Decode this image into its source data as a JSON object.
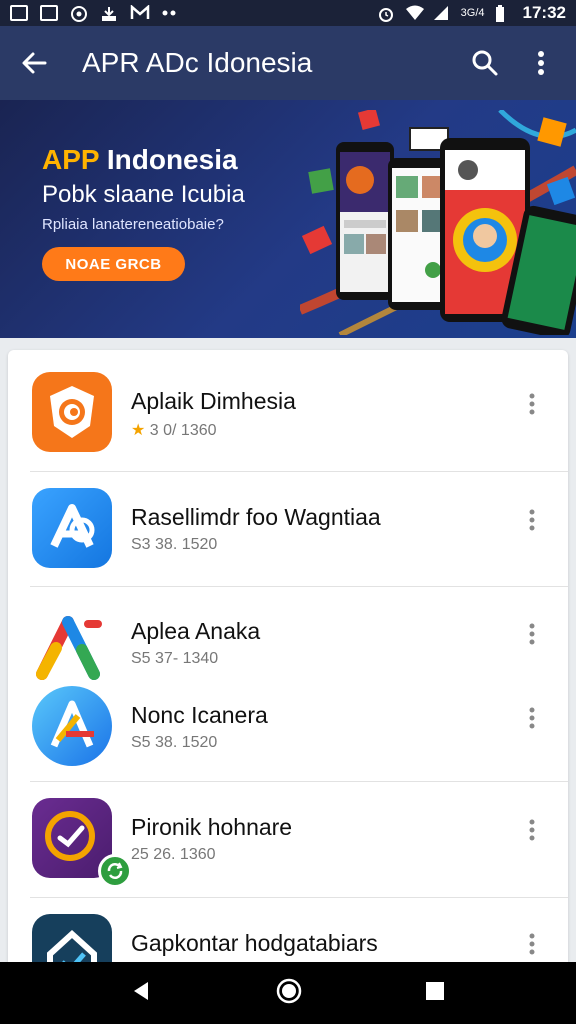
{
  "status_bar": {
    "time": "17:32",
    "signal_text": "3G/4"
  },
  "app_bar": {
    "title": "APR ADc Idonesia"
  },
  "banner": {
    "title_accent": "APP",
    "title_rest": " Indonesia",
    "subtitle": "Pobk slaane Icubia",
    "description": "Rpliaia lanatereneatiobaie?",
    "cta_label": "NOAE GRCB"
  },
  "apps": [
    {
      "name": "Aplaik Dimhesia",
      "meta": "3 0/ 1360",
      "rating_star": true
    },
    {
      "name": "Rasellimdr foo Wagntiaa",
      "meta": "S3 38. 1520"
    },
    {
      "name": "Aplea Anaka",
      "meta": "S5 37- 1340"
    },
    {
      "name": "Nonc Icanera",
      "meta": "S5 38. 1520"
    },
    {
      "name": "Pironik hohnare",
      "meta": "25 26. 1360"
    },
    {
      "name": "Gapkontar hodgatabiars",
      "meta": ""
    }
  ],
  "colors": {
    "accent": "#ff7a18",
    "appbar": "#2b3a66",
    "star": "#f4a300"
  }
}
